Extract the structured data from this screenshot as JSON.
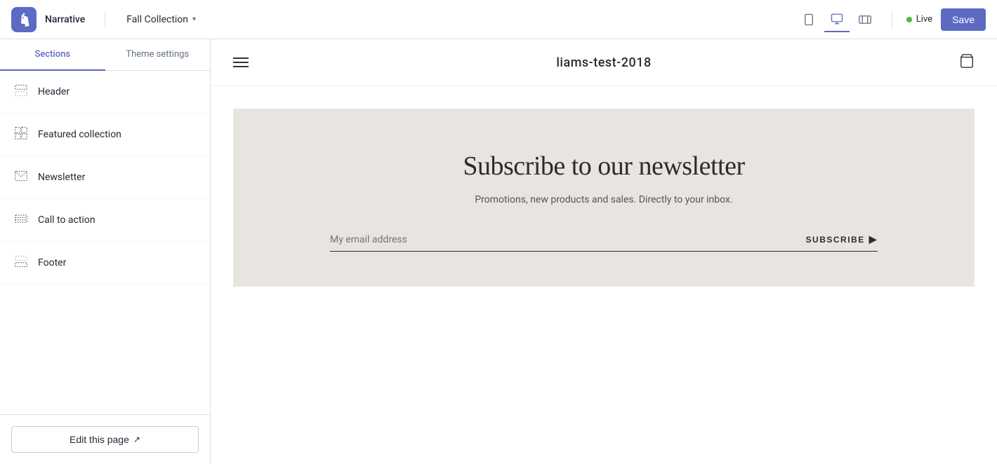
{
  "topbar": {
    "theme_name": "Narrative",
    "collection_name": "Fall Collection",
    "live_label": "Live",
    "save_label": "Save"
  },
  "sidebar": {
    "tab_sections": "Sections",
    "tab_theme_settings": "Theme settings",
    "items": [
      {
        "id": "header",
        "label": "Header",
        "icon": "header-icon"
      },
      {
        "id": "featured-collection",
        "label": "Featured collection",
        "icon": "featured-collection-icon"
      },
      {
        "id": "newsletter",
        "label": "Newsletter",
        "icon": "newsletter-icon"
      },
      {
        "id": "call-to-action",
        "label": "Call to action",
        "icon": "call-to-action-icon"
      },
      {
        "id": "footer",
        "label": "Footer",
        "icon": "footer-icon"
      }
    ],
    "edit_page_label": "Edit this page"
  },
  "preview": {
    "store_name": "liams-test-2018",
    "newsletter": {
      "title": "Subscribe to our newsletter",
      "subtitle": "Promotions, new products and sales. Directly to your inbox.",
      "email_placeholder": "My email address",
      "subscribe_label": "SUBSCRIBE"
    }
  }
}
